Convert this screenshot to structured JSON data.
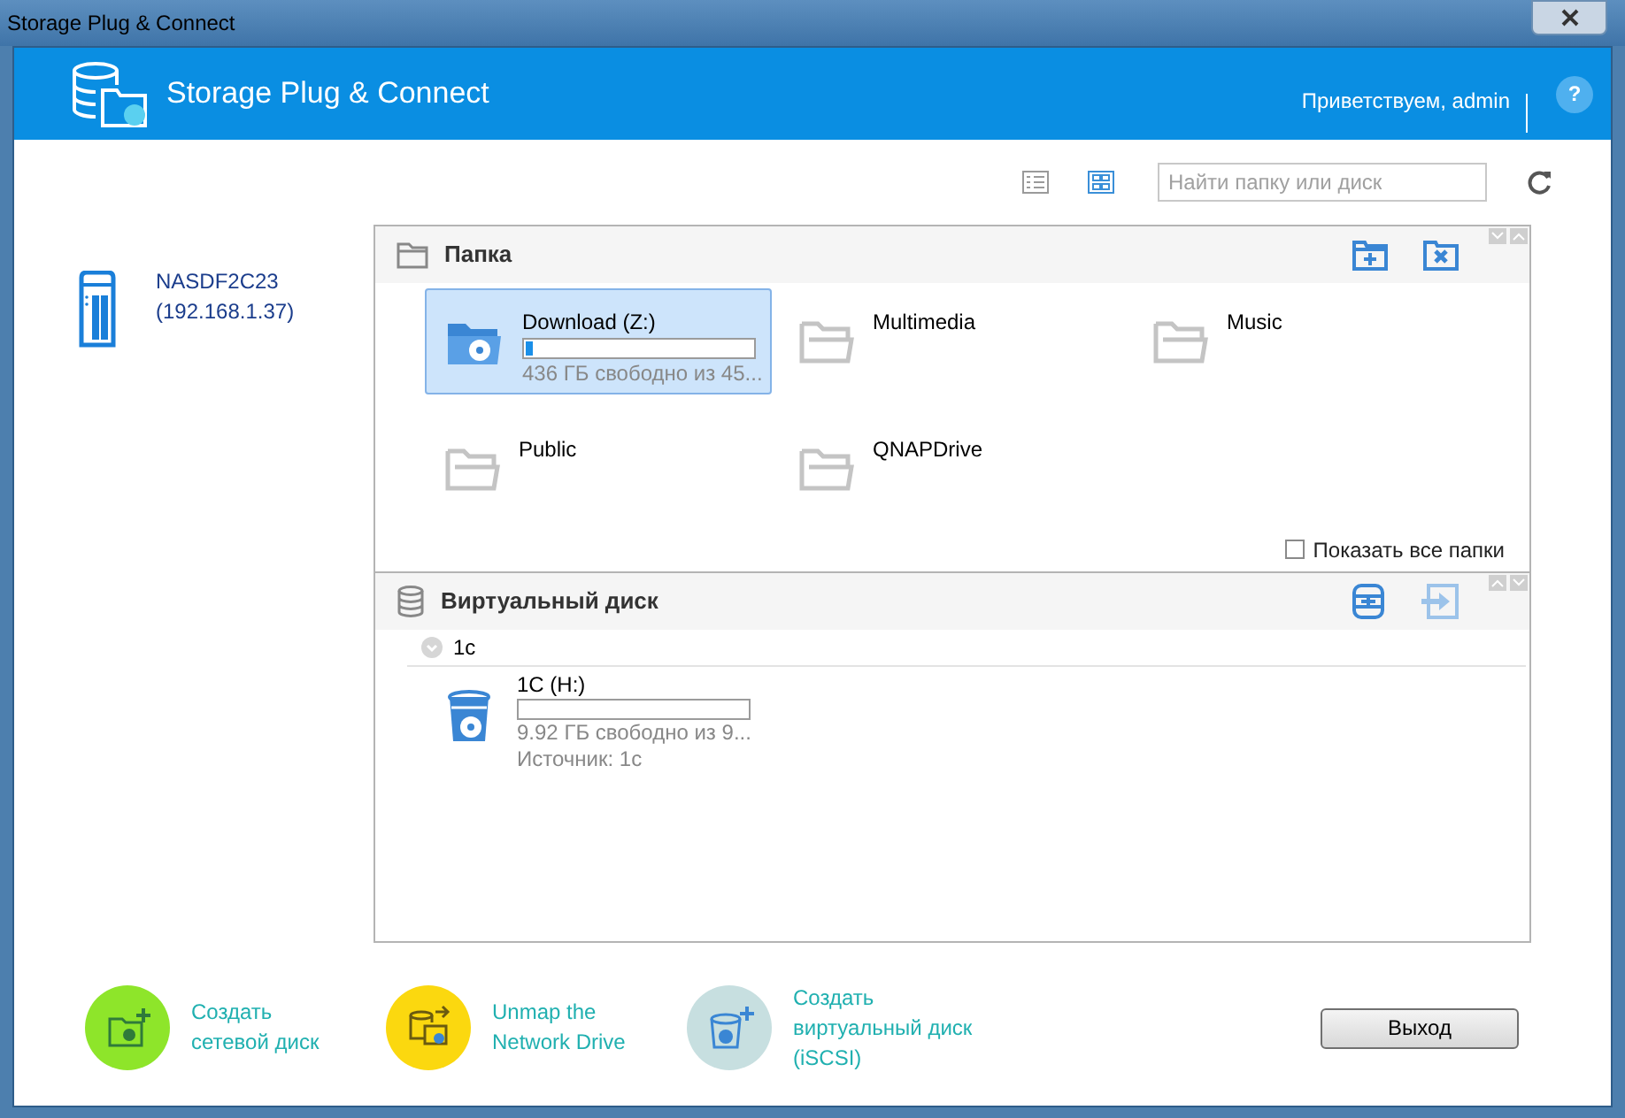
{
  "window": {
    "title": "Storage Plug & Connect"
  },
  "header": {
    "app_name": "Storage Plug & Connect",
    "greeting": "Приветствуем, admin",
    "help": "?"
  },
  "toolbar": {
    "view_modes": [
      {
        "kind": "list",
        "selected": false
      },
      {
        "kind": "grid",
        "selected": true
      }
    ],
    "search": {
      "placeholder": "Найти папку или диск"
    }
  },
  "device": {
    "name": "NASDF2C23",
    "address": "(192.168.1.37)"
  },
  "folder_section": {
    "title": "Папка",
    "folders": [
      {
        "name": "Download (Z:)",
        "selected": true,
        "mapped": true,
        "level": 0.03,
        "detail": "436 ГБ свободно из 45..."
      },
      {
        "name": "Multimedia",
        "selected": false,
        "mapped": false
      },
      {
        "name": "Music",
        "selected": false,
        "mapped": false
      },
      {
        "name": "Public",
        "selected": false,
        "mapped": false
      },
      {
        "name": "QNAPDrive",
        "selected": false,
        "mapped": false
      }
    ],
    "show_all": {
      "label": "Показать все папки",
      "checked": false
    }
  },
  "virtual_section": {
    "title": "Виртуальный диск",
    "groups": [
      {
        "name": "1c",
        "expanded": true,
        "disks": [
          {
            "name": "1C (H:)",
            "level": 0,
            "detail": "9.92 ГБ свободно из 9...",
            "source": "Источник: 1с"
          }
        ]
      }
    ]
  },
  "actions": [
    {
      "kind": "create",
      "label": "Создать сетевой диск",
      "color": "#8ee52a"
    },
    {
      "kind": "unmap",
      "label": "Unmap the Network Drive",
      "color": "#fbd80f"
    },
    {
      "kind": "virtual",
      "label": "Создать виртуальный диск (iSCSI)",
      "color": "#c7dfe0"
    }
  ],
  "exit_button": "Выход"
}
